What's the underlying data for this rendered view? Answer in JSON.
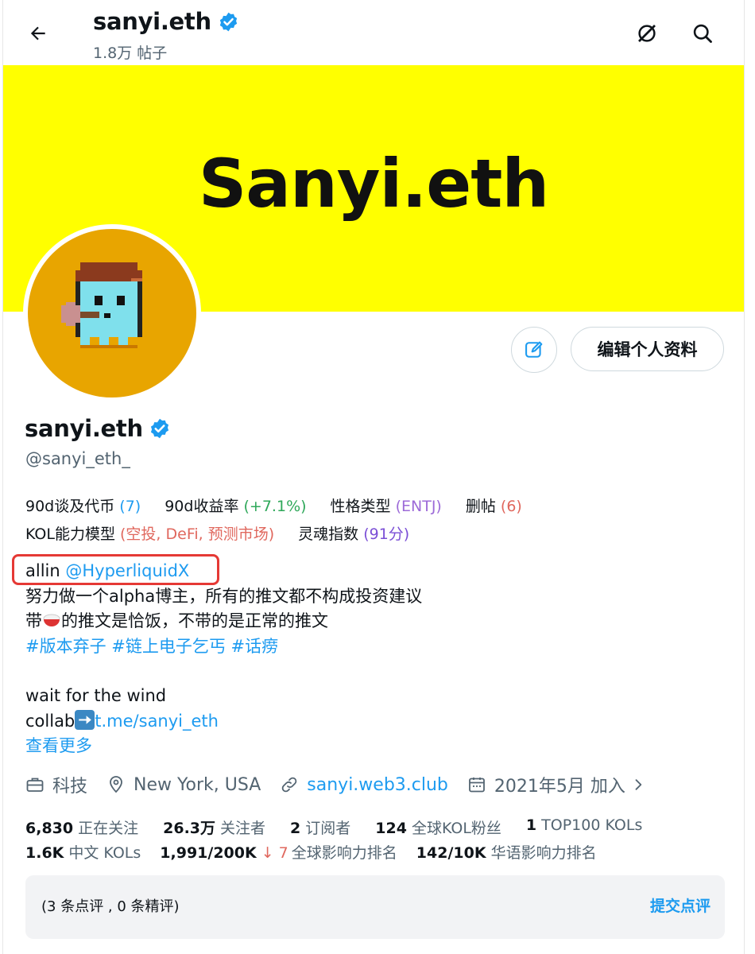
{
  "header": {
    "name": "sanyi.eth",
    "posts": "1.8万 帖子"
  },
  "banner": {
    "text": "Sanyi.eth",
    "bg": "#ffff00"
  },
  "profile": {
    "name": "sanyi.eth",
    "handle": "@sanyi_eth_",
    "edit_button": "编辑个人资料"
  },
  "tags_row1": [
    {
      "label": "90d谈及代币",
      "value": "(7)"
    },
    {
      "label": "90d收益率",
      "value": "(+7.1%)"
    },
    {
      "label": "性格类型",
      "value": "(ENTJ)"
    },
    {
      "label": "删帖",
      "value": "(6)"
    }
  ],
  "tags_row2": [
    {
      "label": "KOL能力模型",
      "value": "(空投, DeFi, 预测市场)"
    },
    {
      "label": "灵魂指数",
      "value": "(91分)"
    }
  ],
  "bio": {
    "line1_text": "allin ",
    "line1_link": "@HyperliquidX",
    "line2": "努力做一个alpha博主，所有的推文都不构成投资建议",
    "line3_a": "带",
    "line3_b": "的推文是恰饭，不带的是正常的推文",
    "hashtags": " #版本弃子 #链上电子乞丐 #话痨",
    "line5": "wait for the wind",
    "collab_text": "collab",
    "collab_link": "t.me/sanyi_eth",
    "more": "查看更多"
  },
  "meta": {
    "category": "科技",
    "location": "New York, USA",
    "website": "sanyi.web3.club",
    "joined": "2021年5月 加入"
  },
  "stats1": [
    {
      "num": "6,830",
      "label": "正在关注"
    },
    {
      "num": "26.3万",
      "label": "关注者"
    },
    {
      "num": "2",
      "label": "订阅者"
    },
    {
      "num": "124",
      "label": "全球KOL粉丝"
    },
    {
      "num": "1",
      "label": "TOP100 KOLs"
    }
  ],
  "stats2": {
    "cn_num": "1.6K",
    "cn_label": "中文 KOLs",
    "global_num": "1,991/200K",
    "global_delta": "↓ 7",
    "global_label": "全球影响力排名",
    "zh_num": "142/10K",
    "zh_label": "华语影响力排名"
  },
  "review": {
    "summary": "(3 条点评 , 0 条精评)",
    "submit": "提交点评"
  }
}
